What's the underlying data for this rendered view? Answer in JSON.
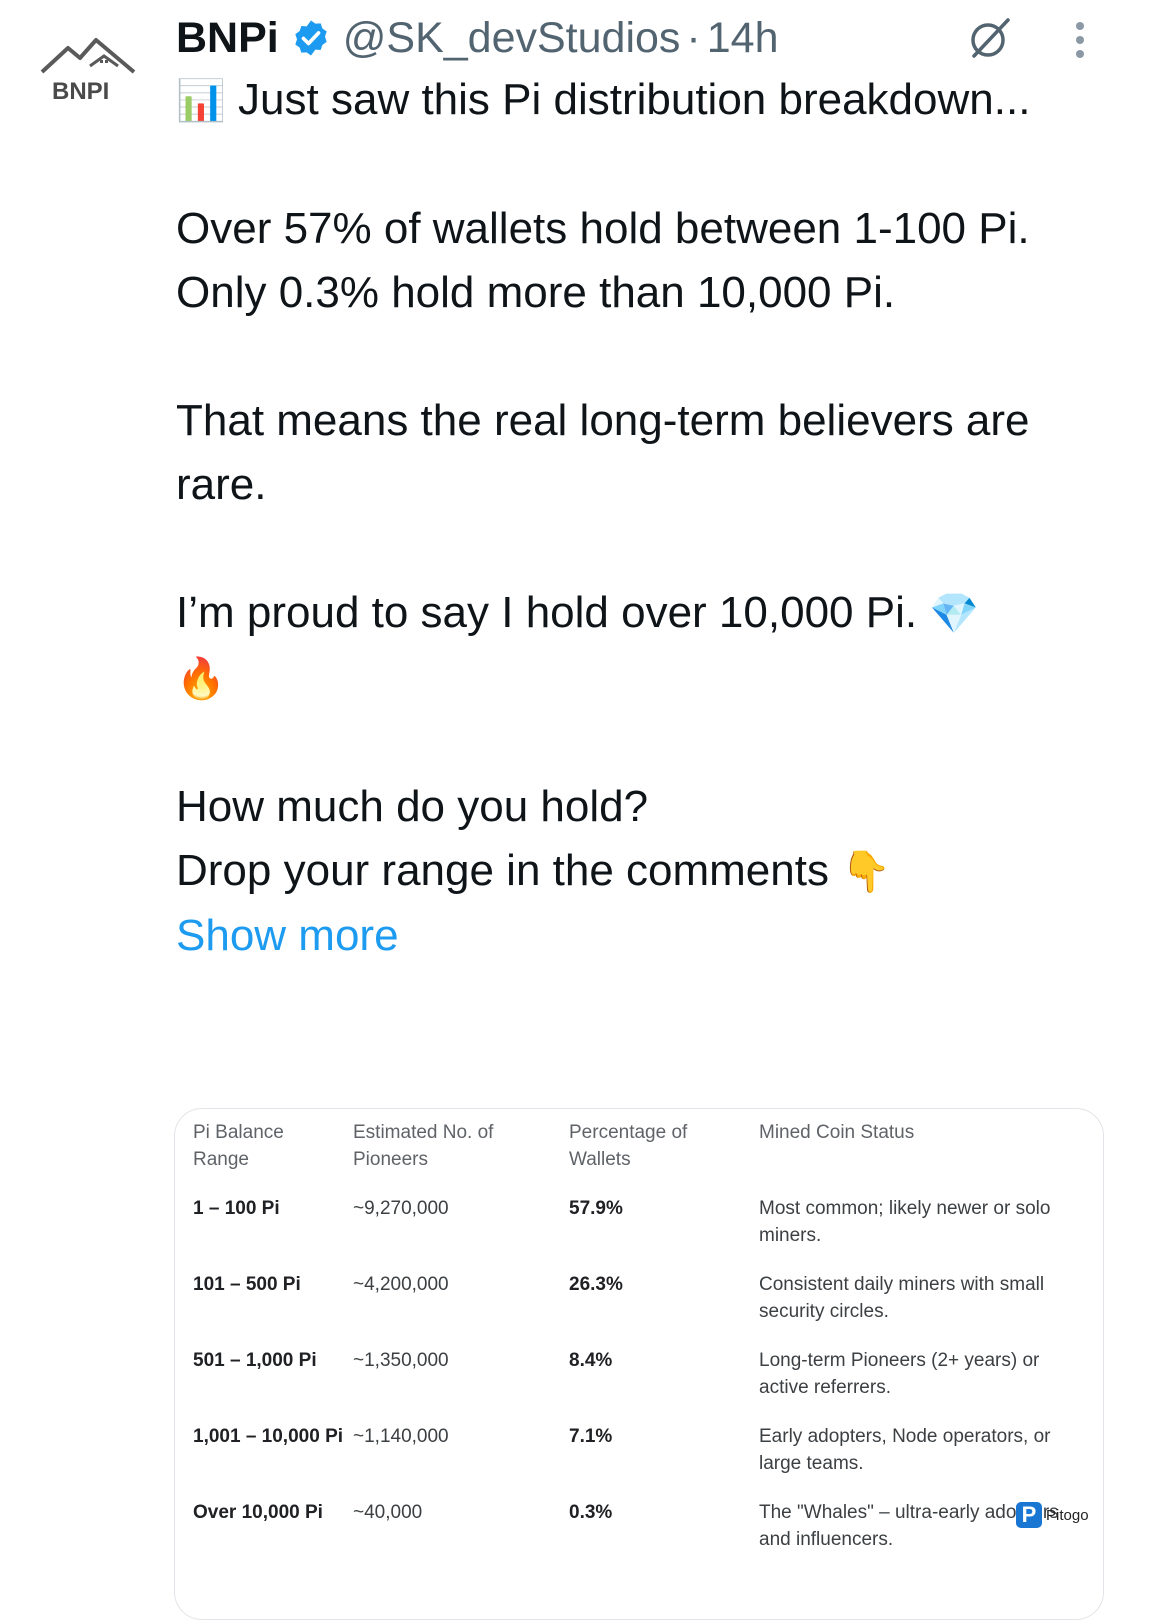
{
  "author": {
    "logo_text": "BNPI",
    "name": "BNPi",
    "handle": "@SK_devStudios",
    "separator": "·",
    "time": "14h"
  },
  "tweet": {
    "line1_emoji": "📊",
    "line1": "Just saw this Pi distribution breakdown...",
    "p2_l1": "Over 57% of wallets hold between 1-100 Pi.",
    "p2_l2": "Only 0.3% hold more than 10,000 Pi.",
    "p3": "That means the real long-term believers are rare.",
    "p4": "I’m proud to say I hold over 10,000 Pi.",
    "p4_emoji1": "💎",
    "p4_emoji2": "🔥",
    "p5_l1": "How much do you hold?",
    "p5_l2": "Drop your range in the comments",
    "p5_emoji": "👇",
    "show_more": "Show more"
  },
  "table": {
    "headers": [
      "Pi Balance\nRange",
      "Estimated No. of\nPioneers",
      "Percentage of\nWallets",
      "Mined Coin Status"
    ],
    "rows": [
      [
        "1 – 100 Pi",
        "~9,270,000",
        "57.9%",
        "Most common; likely newer or solo miners."
      ],
      [
        "101 – 500 Pi",
        "~4,200,000",
        "26.3%",
        "Consistent daily miners with small security circles."
      ],
      [
        "501 – 1,000 Pi",
        "~1,350,000",
        "8.4%",
        "Long-term Pioneers (2+ years) or active referrers."
      ],
      [
        "1,001 – 10,000 Pi",
        "~1,140,000",
        "7.1%",
        "Early adopters, Node operators, or large teams."
      ],
      [
        "Over 10,000 Pi",
        "~40,000",
        "0.3%",
        "The \"Whales\" – ultra-early adopters and influencers."
      ]
    ]
  },
  "watermark": {
    "letter": "P",
    "text": "Pitogo"
  },
  "colors": {
    "link": "#1d9bf0",
    "verified": "#1d9bf0",
    "muted": "#536471"
  },
  "icons": {
    "verified": "verified-badge-icon",
    "grok": "grok-icon",
    "more": "more-vertical-icon"
  }
}
